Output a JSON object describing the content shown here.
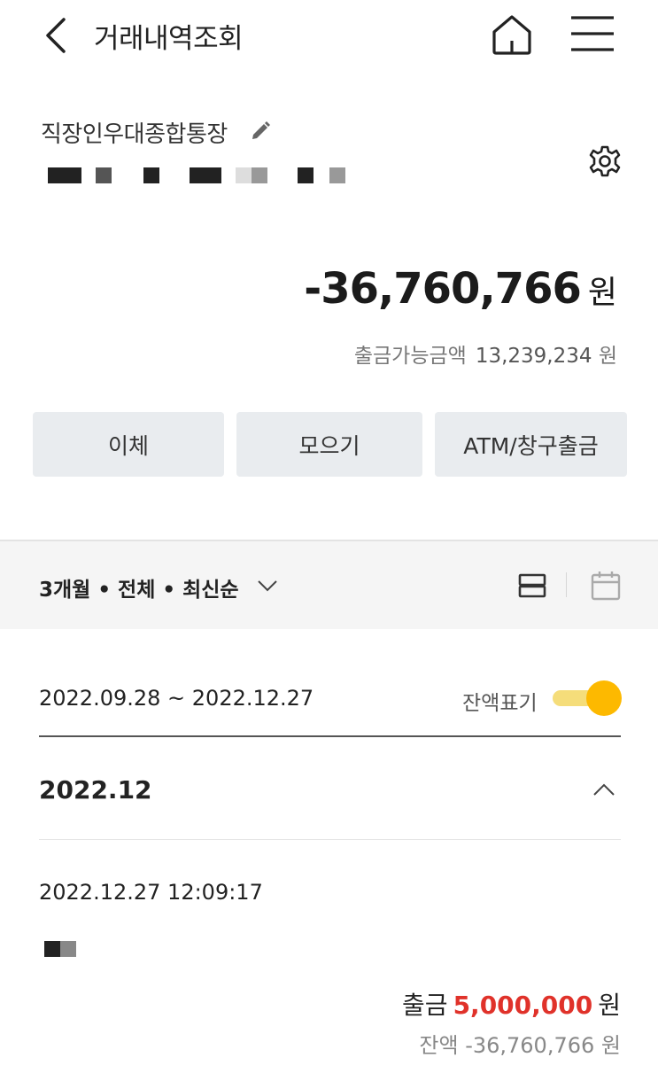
{
  "header": {
    "title": "거래내역조회",
    "back_icon": "chevron-left-icon",
    "home_icon": "home-icon",
    "menu_icon": "hamburger-menu-icon"
  },
  "account": {
    "name": "직장인우대종합통장",
    "edit_icon": "pencil-icon",
    "settings_icon": "gear-icon",
    "number_masked": true
  },
  "balance": {
    "amount": "-36,760,766",
    "unit": "원",
    "available_label": "출금가능금액",
    "available_value": "13,239,234",
    "available_unit": "원"
  },
  "actions": {
    "transfer": "이체",
    "collect": "모으기",
    "atm": "ATM/창구출금"
  },
  "filter": {
    "summary": "3개월 • 전체 • 최신순",
    "dropdown_icon": "chevron-down-icon",
    "list_view_icon": "list-view-icon",
    "calendar_icon": "calendar-icon"
  },
  "period": {
    "range": "2022.09.28 ~ 2022.12.27",
    "balance_toggle_label": "잔액표기",
    "balance_toggle_on": true
  },
  "month_group": {
    "label": "2022.12",
    "collapse_icon": "chevron-up-icon"
  },
  "transaction": {
    "datetime": "2022.12.27 12:09:17",
    "type": "출금",
    "amount": "5,000,000",
    "unit": "원",
    "balance_label": "잔액",
    "balance_value": "-36,760,766",
    "balance_unit": "원"
  },
  "colors": {
    "accent_yellow": "#fdb900",
    "withdraw_red": "#e0322a",
    "button_bg": "#e9ecef"
  }
}
